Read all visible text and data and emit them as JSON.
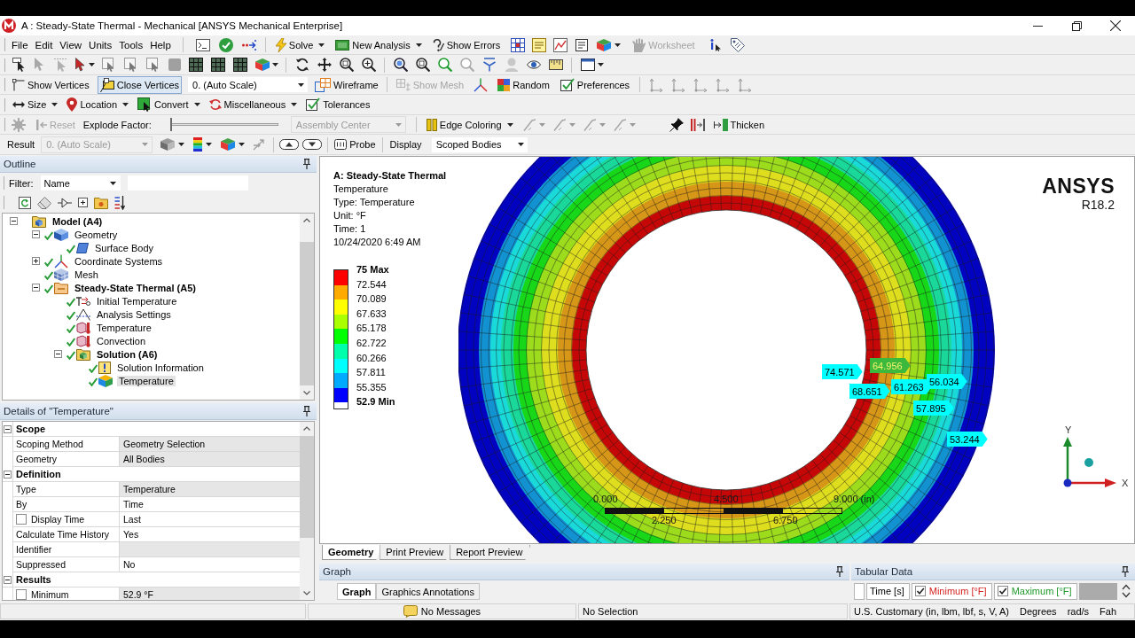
{
  "window": {
    "title": "A : Steady-State Thermal - Mechanical [ANSYS Mechanical Enterprise]"
  },
  "menu": [
    "File",
    "Edit",
    "View",
    "Units",
    "Tools",
    "Help"
  ],
  "standard_toolbar": {
    "buttons": [
      {
        "label": "Solve",
        "disabled": false
      },
      {
        "label": "New Analysis",
        "disabled": false
      },
      {
        "label": "Show Errors",
        "disabled": false
      },
      {
        "label": "Worksheet",
        "disabled": true
      }
    ]
  },
  "display_toolbar": {
    "vertex_buttons": [
      {
        "label": "Show Vertices",
        "on": false
      },
      {
        "label": "Close Vertices",
        "on": true
      }
    ],
    "scale_select": {
      "value": "0. (Auto Scale)"
    },
    "buttons": [
      {
        "label": "Wireframe",
        "disabled": false
      },
      {
        "label": "Show Mesh",
        "disabled": true
      },
      {
        "label": "Random",
        "disabled": false
      },
      {
        "label": "Preferences",
        "disabled": false
      }
    ]
  },
  "connection_toolbar": [
    "Size",
    "Location",
    "Convert",
    "Miscellaneous",
    "Tolerances"
  ],
  "explode_toolbar": {
    "reset": {
      "label": "Reset",
      "disabled": true
    },
    "explode_factor": {
      "label": "Explode Factor:",
      "level": 0
    },
    "center_select": {
      "value": "Assembly Center",
      "disabled": true
    },
    "edge_coloring": "Edge Coloring",
    "thicken": "Thicken"
  },
  "result_toolbar": {
    "label": "Result",
    "scale_select": {
      "value": "0. (Auto Scale)",
      "disabled": true
    },
    "probe": "Probe",
    "display_label": "Display",
    "display_select": {
      "value": "Scoped Bodies"
    }
  },
  "outline": {
    "title": "Outline",
    "filter": {
      "label": "Filter:",
      "value": "Name"
    },
    "tree": [
      {
        "label": "Model (A4)",
        "kind": "model",
        "expanded": true,
        "selected": false,
        "children": [
          {
            "label": "Geometry",
            "kind": "geometry",
            "expanded": true,
            "selected": false,
            "children": [
              {
                "label": "Surface Body",
                "kind": "body",
                "selected": false
              }
            ]
          },
          {
            "label": "Coordinate Systems",
            "kind": "coordinates",
            "expanded": false,
            "selected": false
          },
          {
            "label": "Mesh",
            "kind": "mesh",
            "selected": false
          },
          {
            "label": "Steady-State Thermal (A5)",
            "kind": "analysis",
            "expanded": true,
            "selected": false,
            "children": [
              {
                "label": "Initial Temperature",
                "kind": "initial",
                "selected": false
              },
              {
                "label": "Analysis Settings",
                "kind": "settings",
                "selected": false
              },
              {
                "label": "Temperature",
                "kind": "load",
                "selected": false
              },
              {
                "label": "Convection",
                "kind": "load",
                "selected": false
              },
              {
                "label": "Solution (A6)",
                "kind": "solution",
                "expanded": true,
                "selected": false,
                "children": [
                  {
                    "label": "Solution Information",
                    "kind": "info",
                    "selected": false
                  },
                  {
                    "label": "Temperature",
                    "kind": "result",
                    "selected": true
                  }
                ]
              }
            ]
          }
        ]
      }
    ]
  },
  "details": {
    "title": "Details of \"Temperature\"",
    "groups": [
      {
        "label": "Scope",
        "expanded": true,
        "rows": [
          {
            "kind": "field",
            "label": "Scoping Method",
            "value": "Geometry Selection",
            "shaded": true
          },
          {
            "kind": "field",
            "label": "Geometry",
            "value": "All Bodies",
            "shaded": true
          }
        ]
      },
      {
        "label": "Definition",
        "expanded": true,
        "rows": [
          {
            "kind": "field",
            "label": "Type",
            "value": "Temperature",
            "shaded": true
          },
          {
            "kind": "field",
            "label": "By",
            "value": "Time",
            "shaded": false
          },
          {
            "kind": "checkbox",
            "label": "Display Time",
            "value": "Last",
            "checked": false,
            "shaded": false
          },
          {
            "kind": "field",
            "label": "Calculate Time History",
            "value": "Yes",
            "shaded": false
          },
          {
            "kind": "field",
            "label": "Identifier",
            "shaded": true
          },
          {
            "kind": "field",
            "label": "Suppressed",
            "value": "No",
            "shaded": false
          }
        ]
      },
      {
        "label": "Results",
        "expanded": true,
        "rows": [
          {
            "kind": "checkbox",
            "label": "Minimum",
            "value": "52.9 °F",
            "checked": false,
            "shaded": true
          }
        ]
      }
    ]
  },
  "graphics": {
    "annotation": {
      "title": "A: Steady-State Thermal",
      "lines": [
        "Temperature",
        "Type: Temperature",
        "Unit: °F",
        "Time: 1",
        "10/24/2020 6:49 AM"
      ]
    },
    "legend": {
      "labels": [
        "75 Max",
        "72.544",
        "70.089",
        "67.633",
        "65.178",
        "62.722",
        "60.266",
        "57.811",
        "55.355",
        "52.9 Min"
      ],
      "bands": [
        {
          "color": "#ff0000"
        },
        {
          "color": "#ffaa00"
        },
        {
          "color": "#ffff00"
        },
        {
          "color": "#aaff00"
        },
        {
          "color": "#00ff00"
        },
        {
          "color": "#00ffaa"
        },
        {
          "color": "#00ffff"
        },
        {
          "color": "#00aaff"
        },
        {
          "color": "#0000ff"
        }
      ]
    },
    "logo": {
      "name": "ANSYS",
      "version": "R18.2"
    },
    "probes": [
      {
        "value": "64.956",
        "selected": true
      },
      {
        "value": "74.571",
        "selected": false
      },
      {
        "value": "56.034",
        "selected": false
      },
      {
        "value": "61.263",
        "selected": false
      },
      {
        "value": "68.651",
        "selected": false
      },
      {
        "value": "57.895",
        "selected": false
      },
      {
        "value": "53.244",
        "selected": false
      }
    ],
    "scale_bar": {
      "top_labels": [
        "0.000",
        "4.500",
        "9.000 (in)"
      ],
      "bottom_labels": [
        "2.250",
        "6.750"
      ]
    },
    "triad": {
      "y_label": "Y",
      "x_label": "X"
    }
  },
  "view_tabs": [
    {
      "label": "Geometry",
      "selected": true
    },
    {
      "label": "Print Preview",
      "selected": false
    },
    {
      "label": "Report Preview",
      "selected": false
    }
  ],
  "graph_panel": {
    "title": "Graph",
    "tabs": [
      {
        "label": "Graph",
        "selected": true
      },
      {
        "label": "Graphics Annotations",
        "selected": false
      }
    ]
  },
  "tabular_data": {
    "title": "Tabular Data",
    "columns": [
      {
        "kind": "plain",
        "label": "Time [s]"
      },
      {
        "kind": "checkbox",
        "label": "Minimum [°F]",
        "checked": true,
        "color": "#d62020"
      },
      {
        "kind": "checkbox",
        "label": "Maximum [°F]",
        "checked": true,
        "color": "#1f9a2a"
      }
    ]
  },
  "status_bar": {
    "messages": "No Messages",
    "selection": "No Selection",
    "units": "U.S. Customary (in, lbm, lbf, s, V, A)",
    "angle_unit": "Degrees",
    "rate_unit": "rad/s",
    "temperature_unit": "Fah"
  }
}
